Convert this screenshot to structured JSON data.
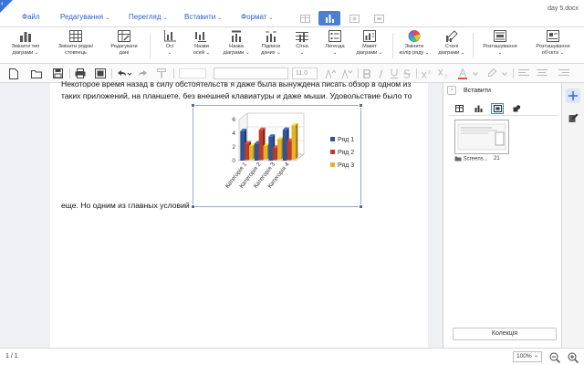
{
  "title_bar": {
    "doc_name": "day 5.docx",
    "menu": [
      {
        "label": "Файл",
        "chevron": false
      },
      {
        "label": "Редагування",
        "chevron": true
      },
      {
        "label": "Перегляд",
        "chevron": true
      },
      {
        "label": "Вставити",
        "chevron": true
      },
      {
        "label": "Формат",
        "chevron": true
      }
    ],
    "chevron_glyph": "⌄"
  },
  "ribbon": {
    "items": [
      {
        "label": "Змінити тип\nдіаграми ⌄",
        "icon": "chart-type-icon"
      },
      {
        "label": "Змінити рядок/\nстовпець",
        "icon": "switch-row-column-icon"
      },
      {
        "label": "Редагувати\nдані",
        "icon": "edit-data-icon"
      },
      {
        "label": "Осі\n⌄",
        "icon": "axes-icon"
      },
      {
        "label": "Назви\nосей ⌄",
        "icon": "axis-titles-icon"
      },
      {
        "label": "Назва\nдіаграми ⌄",
        "icon": "chart-title-icon"
      },
      {
        "label": "Підписи\nданих ⌄",
        "icon": "data-labels-icon"
      },
      {
        "label": "Сітка\n⌄",
        "icon": "gridlines-icon"
      },
      {
        "label": "Легенда\n⌄",
        "icon": "legend-icon"
      },
      {
        "label": "Макет\nдіаграми ⌄",
        "icon": "chart-layout-icon"
      },
      {
        "label": "Змінити\nколір ряду ⌄",
        "icon": "series-color-icon"
      },
      {
        "label": "Стилі\nдіаграми ⌄",
        "icon": "chart-styles-icon"
      },
      {
        "label": "Розташування\n⌄",
        "icon": "position-icon"
      },
      {
        "label": "Розташування\nоб'єкта ⌄",
        "icon": "object-position-icon"
      }
    ]
  },
  "format_toolbar": {
    "font_size": "11.0"
  },
  "document": {
    "lines": [
      "Некоторое время назад в силу обстоятельств я даже была вынуждена писать обзор в одном из",
      "таких приложений, на планшете, без внешней клавиатуры и даже мыши. Удовольствие было то",
      "еще. Но одним из главных условий"
    ]
  },
  "chart_data": {
    "type": "bar",
    "style": "3d-clustered-column",
    "categories": [
      "Категорія 1",
      "Категорія 2",
      "Категорія 3",
      "Категорія 4"
    ],
    "series": [
      {
        "name": "Ряд 1",
        "values": [
          4.3,
          2.5,
          3.5,
          4.5
        ],
        "color": "#2f5597"
      },
      {
        "name": "Ряд 2",
        "values": [
          2.4,
          4.4,
          1.8,
          2.8
        ],
        "color": "#c0392b"
      },
      {
        "name": "Ряд 3",
        "values": [
          2.0,
          2.0,
          3.0,
          5.0
        ],
        "color": "#e6b422"
      }
    ],
    "y_ticks": [
      "0",
      "2",
      "4",
      "6"
    ],
    "ylim": [
      0,
      6
    ],
    "legend_position": "right",
    "gridlines": true
  },
  "side_panel": {
    "title": "Вставити",
    "collapse_glyph": "›",
    "thumbnail": {
      "name": "Screens...",
      "count": "21"
    },
    "collection_button": "Колекція"
  },
  "status_bar": {
    "page_count": "1 / 1",
    "zoom": "100%",
    "zoom_chevron": "⌄"
  }
}
